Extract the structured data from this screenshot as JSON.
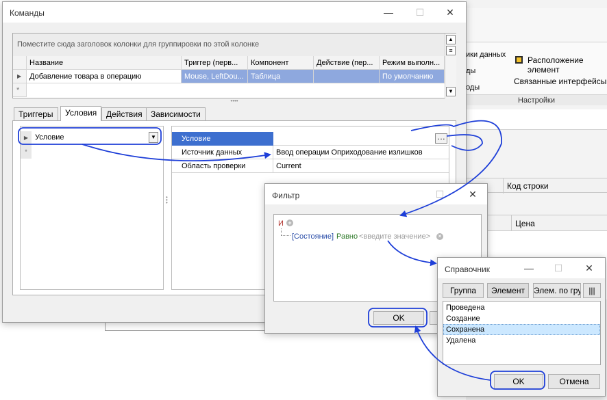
{
  "main_window": {
    "title": "Команды",
    "group_hint": "Поместите сюда заголовок колонки для группировки по этой колонке",
    "columns": [
      "Название",
      "Триггер (перв...",
      "Компонент",
      "Действие (пер...",
      "Режим выполн..."
    ],
    "row": [
      "Добавление товара в операцию",
      "Mouse, LeftDou...",
      "Таблица",
      "",
      "По умолчанию"
    ],
    "tabs": [
      "Триггеры",
      "Условия",
      "Действия",
      "Зависимости"
    ],
    "condition_selector": "Условие",
    "properties": [
      {
        "name": "Условие",
        "value": ""
      },
      {
        "name": "Источник данных",
        "value": "Ввод операции Оприходование излишков"
      },
      {
        "name": "Область проверки",
        "value": "Current"
      }
    ]
  },
  "background_app": {
    "ribbon_items": [
      "ики данных",
      "ды",
      "оды"
    ],
    "layout_label": "Расположение элемент",
    "linked_interfaces": "Связанные интерфейсы",
    "settings_group": "Настройки",
    "col_row_code": "Код строки",
    "col_price": "Цена"
  },
  "filter_dialog": {
    "title": "Фильтр",
    "and_operator": "И",
    "field": "[Состояние]",
    "operator": "Равно",
    "value_placeholder": "<введите значение>",
    "ok": "OK"
  },
  "reference_dialog": {
    "title": "Справочник",
    "buttons": [
      "Группа",
      "Элемент",
      "Элем. по груп"
    ],
    "items": [
      "Проведена",
      "Создание",
      "Сохранена",
      "Удалена"
    ],
    "selected_index": 2,
    "ok": "OK",
    "cancel": "Отмена"
  },
  "colors": {
    "selection": "#8ea8de",
    "property_selected": "#3d6fcf",
    "annotation": "#1e3fd8",
    "list_selected": "#cce8ff"
  }
}
